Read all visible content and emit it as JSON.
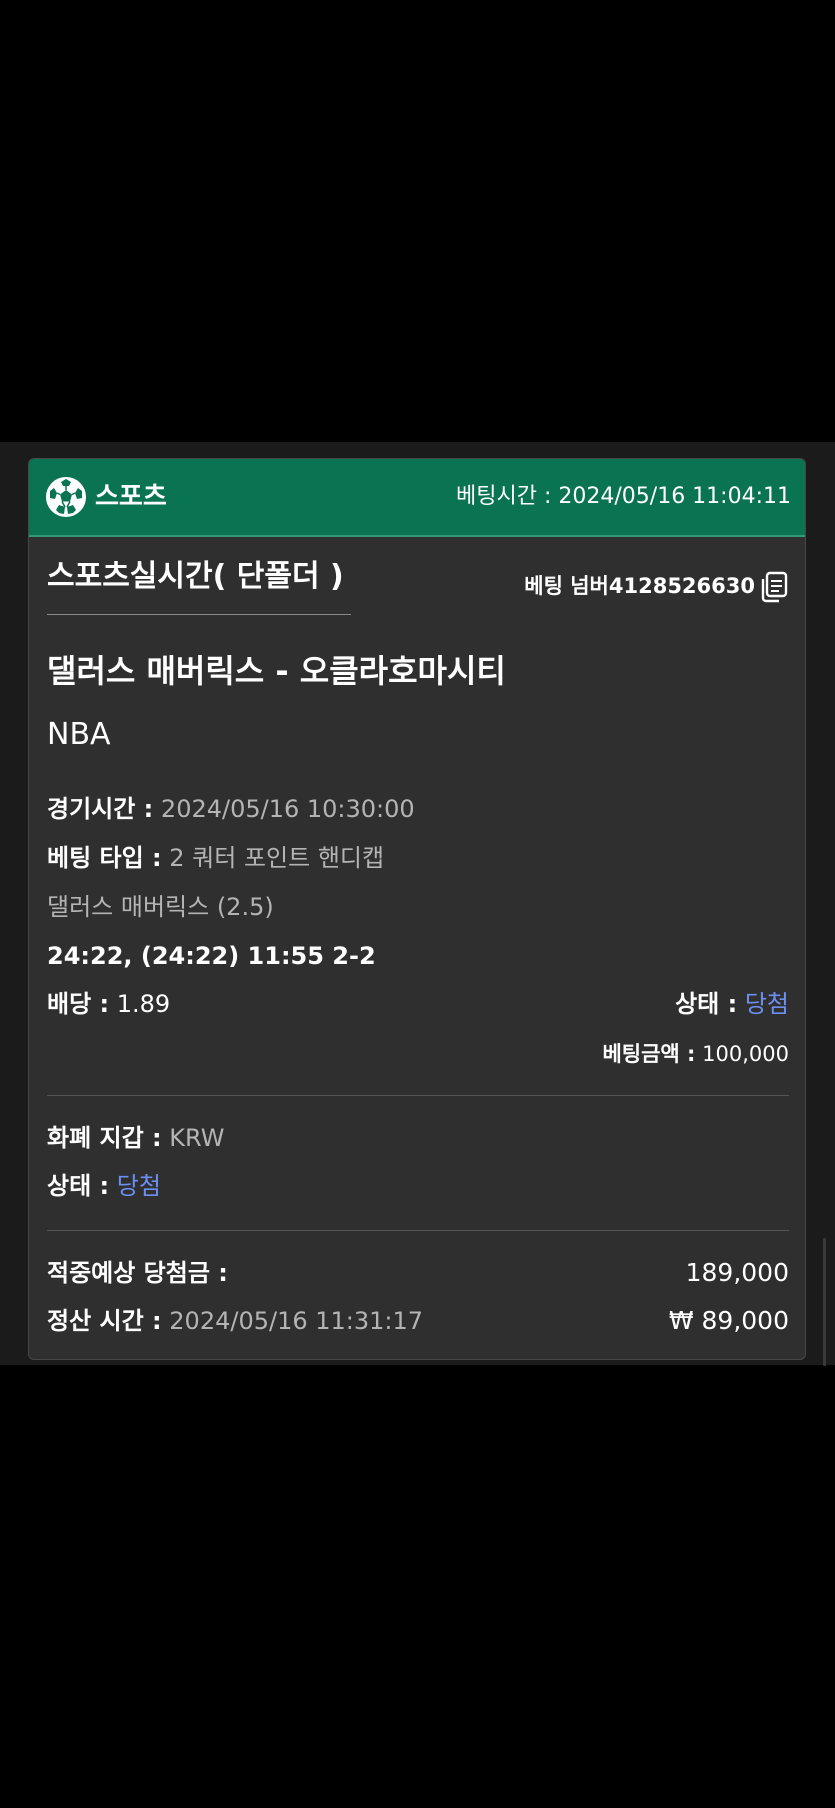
{
  "header": {
    "category": "스포츠",
    "bet_time_label": "베팅시간 :",
    "bet_time_value": "2024/05/16 11:04:11",
    "ball_icon": "soccer-ball-icon"
  },
  "bet": {
    "title": "스포츠실시간( 단폴더 )",
    "number_label": "베팅 넘버",
    "number_value": "4128526630",
    "copy_icon": "copy-icon"
  },
  "match": {
    "name": "댈러스 매버릭스 - 오클라호마시티",
    "league": "NBA",
    "game_time_label": "경기시간 :",
    "game_time_value": "2024/05/16 10:30:00",
    "bet_type_label": "베팅 타입 :",
    "bet_type_value": "2 쿼터 포인트 핸디캡",
    "selection": "댈러스 매버릭스 (2.5)",
    "score_line": "24:22, (24:22) 11:55 2-2",
    "odds_label": "배당 :",
    "odds_value": "1.89",
    "status_label": "상태 :",
    "status_value": "당첨",
    "amount_label": "베팅금액 :",
    "amount_value": "100,000"
  },
  "wallet": {
    "currency_label": "화폐 지갑 :",
    "currency_value": "KRW",
    "status_label": "상태 :",
    "status_value": "당첨"
  },
  "settlement": {
    "expected_win_label": "적중예상 당첨금 :",
    "expected_win_value": "189,000",
    "settle_time_label": "정산 시간 :",
    "settle_time_value": "2024/05/16 11:31:17",
    "profit_value": "₩ 89,000"
  },
  "colors": {
    "header_green": "#0a7352",
    "accent_blue": "#6c8ff2",
    "card_bg": "#2f2f2f",
    "page_bg": "#000000"
  }
}
